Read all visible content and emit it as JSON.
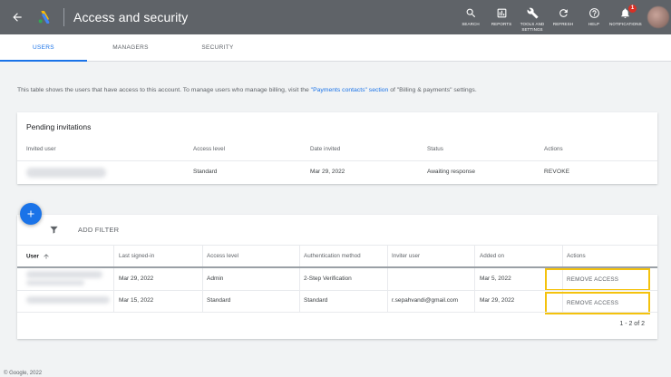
{
  "header": {
    "title": "Access and security",
    "tools": [
      {
        "name": "search",
        "label": "SEARCH"
      },
      {
        "name": "reports",
        "label": "REPORTS"
      },
      {
        "name": "tools",
        "label": "TOOLS AND SETTINGS"
      },
      {
        "name": "refresh",
        "label": "REFRESH"
      },
      {
        "name": "help",
        "label": "HELP"
      },
      {
        "name": "notifications",
        "label": "NOTIFICATIONS",
        "badge": "1"
      }
    ]
  },
  "tabs": [
    {
      "label": "USERS",
      "active": true
    },
    {
      "label": "MANAGERS",
      "active": false
    },
    {
      "label": "SECURITY",
      "active": false
    }
  ],
  "info": {
    "before": "This table shows the users that have access to this account. To manage users who manage billing, visit the ",
    "link": "\"Payments contacts\" section",
    "after": " of \"Billing & payments\" settings."
  },
  "pending": {
    "title": "Pending invitations",
    "columns": [
      "Invited user",
      "Access level",
      "Date invited",
      "Status",
      "Actions"
    ],
    "rows": [
      {
        "access": "Standard",
        "date": "Mar 29, 2022",
        "status": "Awaiting response",
        "action": "REVOKE"
      }
    ]
  },
  "users": {
    "add_filter": "ADD FILTER",
    "columns": [
      "User",
      "Last signed-in",
      "Access level",
      "Authentication method",
      "Inviter user",
      "Added on",
      "Actions"
    ],
    "rows": [
      {
        "last_signed": "Mar 29, 2022",
        "access": "Admin",
        "auth": "2-Step Verification",
        "inviter": "",
        "added": "Mar 5, 2022",
        "action": "REMOVE ACCESS"
      },
      {
        "last_signed": "Mar 15, 2022",
        "access": "Standard",
        "auth": "Standard",
        "inviter": "r.sepahvandi@gmail.com",
        "added": "Mar 29, 2022",
        "action": "REMOVE ACCESS"
      }
    ],
    "pagination": "1 - 2 of 2"
  },
  "footer": "© Google, 2022",
  "colors": {
    "topbar": "#5f6368",
    "accent": "#1a73e8",
    "highlight": "#f4c20d",
    "badge": "#d93025"
  }
}
